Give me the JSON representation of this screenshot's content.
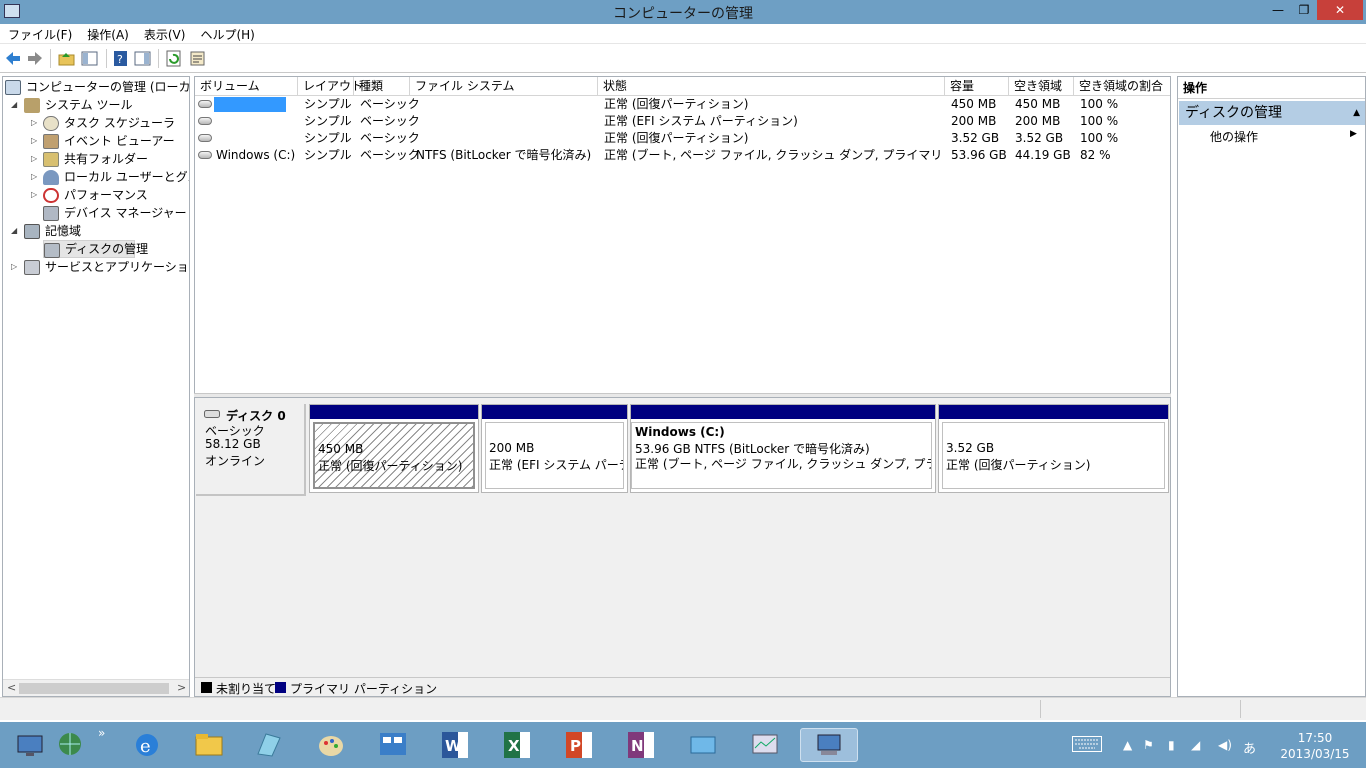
{
  "window": {
    "title": "コンピューターの管理",
    "min": "—",
    "max": "❐",
    "close": "✕"
  },
  "menu": [
    "ファイル(F)",
    "操作(A)",
    "表示(V)",
    "ヘルプ(H)"
  ],
  "tree": {
    "root": "コンピューターの管理 (ローカル)",
    "system_tools": "システム ツール",
    "task_scheduler": "タスク スケジューラ",
    "event_viewer": "イベント ビューアー",
    "shared_folders": "共有フォルダー",
    "local_users": "ローカル ユーザーとグループ",
    "performance": "パフォーマンス",
    "device_manager": "デバイス マネージャー",
    "storage": "記憶域",
    "disk_management": "ディスクの管理",
    "services_apps": "サービスとアプリケーション"
  },
  "columns": [
    "ボリューム",
    "レイアウト",
    "種類",
    "ファイル システム",
    "状態",
    "容量",
    "空き領域",
    "空き領域の割合"
  ],
  "volumes": [
    {
      "name": "",
      "layout": "シンプル",
      "type": "ベーシック",
      "fs": "",
      "status": "正常 (回復パーティション)",
      "capacity": "450 MB",
      "free": "450 MB",
      "pct": "100 %"
    },
    {
      "name": "",
      "layout": "シンプル",
      "type": "ベーシック",
      "fs": "",
      "status": "正常 (EFI システム パーティション)",
      "capacity": "200 MB",
      "free": "200 MB",
      "pct": "100 %"
    },
    {
      "name": "",
      "layout": "シンプル",
      "type": "ベーシック",
      "fs": "",
      "status": "正常 (回復パーティション)",
      "capacity": "3.52 GB",
      "free": "3.52 GB",
      "pct": "100 %"
    },
    {
      "name": "Windows (C:)",
      "layout": "シンプル",
      "type": "ベーシック",
      "fs": "NTFS (BitLocker で暗号化済み)",
      "status": "正常 (ブート, ページ ファイル, クラッシュ ダンプ, プライマリ パーティション)",
      "capacity": "53.96 GB",
      "free": "44.19 GB",
      "pct": "82 %"
    }
  ],
  "disk": {
    "name": "ディスク 0",
    "kind": "ベーシック",
    "size": "58.12 GB",
    "state": "オンライン"
  },
  "partitions": [
    {
      "title": "",
      "line1": "450 MB",
      "line2": "正常 (回復パーティション)"
    },
    {
      "title": "",
      "line1": "200 MB",
      "line2": "正常 (EFI システム パーティ"
    },
    {
      "title": "Windows  (C:)",
      "line1": "53.96 GB NTFS (BitLocker で暗号化済み)",
      "line2": "正常 (ブート, ページ ファイル, クラッシュ ダンプ, プライマリ パー:"
    },
    {
      "title": "",
      "line1": "3.52 GB",
      "line2": "正常 (回復パーティション)"
    }
  ],
  "legend": {
    "unallocated": "未割り当て",
    "primary": "プライマリ パーティション",
    "unallocated_color": "#000000",
    "primary_color": "#000080"
  },
  "actions": {
    "header": "操作",
    "section": "ディスクの管理",
    "more": "他の操作"
  },
  "tray": {
    "ime": "あ",
    "time": "17:50",
    "date": "2013/03/15"
  }
}
